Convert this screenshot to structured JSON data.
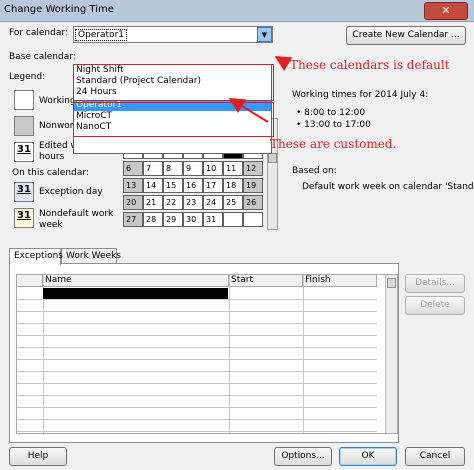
{
  "window": {
    "title": "Change Working Time",
    "close_glyph": "✕"
  },
  "for_calendar": {
    "label": "For calendar:",
    "value": "Operator1"
  },
  "base_calendar": {
    "label": "Base calendar:"
  },
  "create_button": "Create New Calendar ...",
  "dropdown": {
    "items": [
      "Night Shift",
      "Standard (Project Calendar)",
      "24 Hours",
      "Operator1",
      "MicroCT",
      "NanoCT"
    ],
    "selected_index": 3
  },
  "legend": {
    "title": "Legend:",
    "working": "Working",
    "nonworking": "Nonworking",
    "edited_hours_1": "Edited working",
    "edited_hours_2": "hours",
    "edited_number": "31",
    "on_this_calendar": "On this calendar:",
    "exception_day": "Exception day",
    "exception_number": "31",
    "nondefault_1": "Nondefault work",
    "nondefault_2": "week",
    "nondefault_number": "31"
  },
  "working_times": {
    "heading": "Working times for 2014 July 4:",
    "times": [
      "8:00 to 12:00",
      "13:00 to 17:00"
    ],
    "based_on_label": "Based on:",
    "based_on_text": "Default work week on calendar 'Standard'."
  },
  "calendar_grid": {
    "rows": [
      [
        "",
        "",
        "",
        "",
        "",
        "",
        ""
      ],
      [
        "6",
        "7",
        "8",
        "9",
        "10",
        "11",
        "12"
      ],
      [
        "13",
        "14",
        "15",
        "16",
        "17",
        "18",
        "19"
      ],
      [
        "20",
        "21",
        "22",
        "23",
        "24",
        "25",
        "26"
      ],
      [
        "27",
        "28",
        "29",
        "30",
        "31",
        "",
        ""
      ]
    ]
  },
  "tabs": [
    "Exceptions",
    "Work Weeks"
  ],
  "table": {
    "columns": [
      "Name",
      "Start",
      "Finish"
    ]
  },
  "side_buttons": {
    "details": "Details...",
    "delete": "Delete"
  },
  "bottom_buttons": {
    "help": "Help",
    "options": "Options...",
    "ok": "OK",
    "cancel": "Cancel"
  },
  "annotations": {
    "default_note": "These calendars is default",
    "custom_note": "These are customed.",
    "color": "#e02020"
  }
}
